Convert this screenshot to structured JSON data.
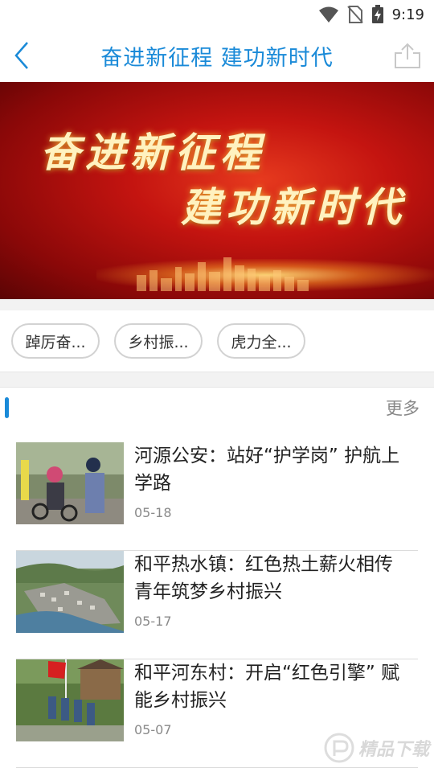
{
  "status_bar": {
    "time": "9:19"
  },
  "header": {
    "title": "奋进新征程 建功新时代"
  },
  "banner": {
    "line1": "奋进新征程",
    "line2": "建功新时代"
  },
  "chips": [
    {
      "label": "踔厉奋..."
    },
    {
      "label": "乡村振..."
    },
    {
      "label": "虎力全..."
    }
  ],
  "section": {
    "more_label": "更多"
  },
  "news": [
    {
      "title": "河源公安：站好“护学岗” 护航上学路",
      "date": "05-18"
    },
    {
      "title": "和平热水镇：红色热土薪火相传 青年筑梦乡村振兴",
      "date": "05-17"
    },
    {
      "title": "和平河东村：开启“红色引擎” 赋能乡村振兴",
      "date": "05-07"
    }
  ],
  "watermark": {
    "text": "精品下载"
  },
  "colors": {
    "accent": "#1a8ad8",
    "banner_red": "#c41410"
  }
}
